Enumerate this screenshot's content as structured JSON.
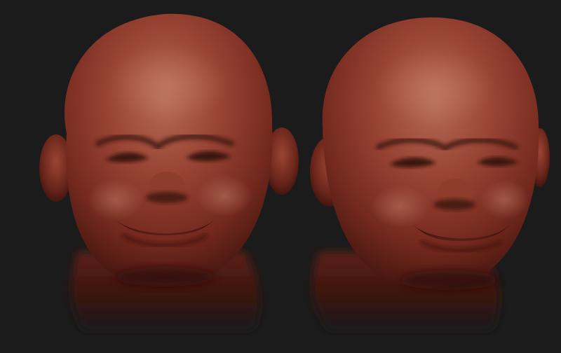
{
  "scene": {
    "background_color": "#1b1b1b",
    "clay_base_color": "#8a3a2c",
    "clay_highlight_color": "#b8705c",
    "clay_shadow_color": "#2a0f0b",
    "models": [
      {
        "name": "sculpt-head-left",
        "view": "front-three-quarter"
      },
      {
        "name": "sculpt-head-right",
        "view": "three-quarter-turned"
      }
    ]
  }
}
